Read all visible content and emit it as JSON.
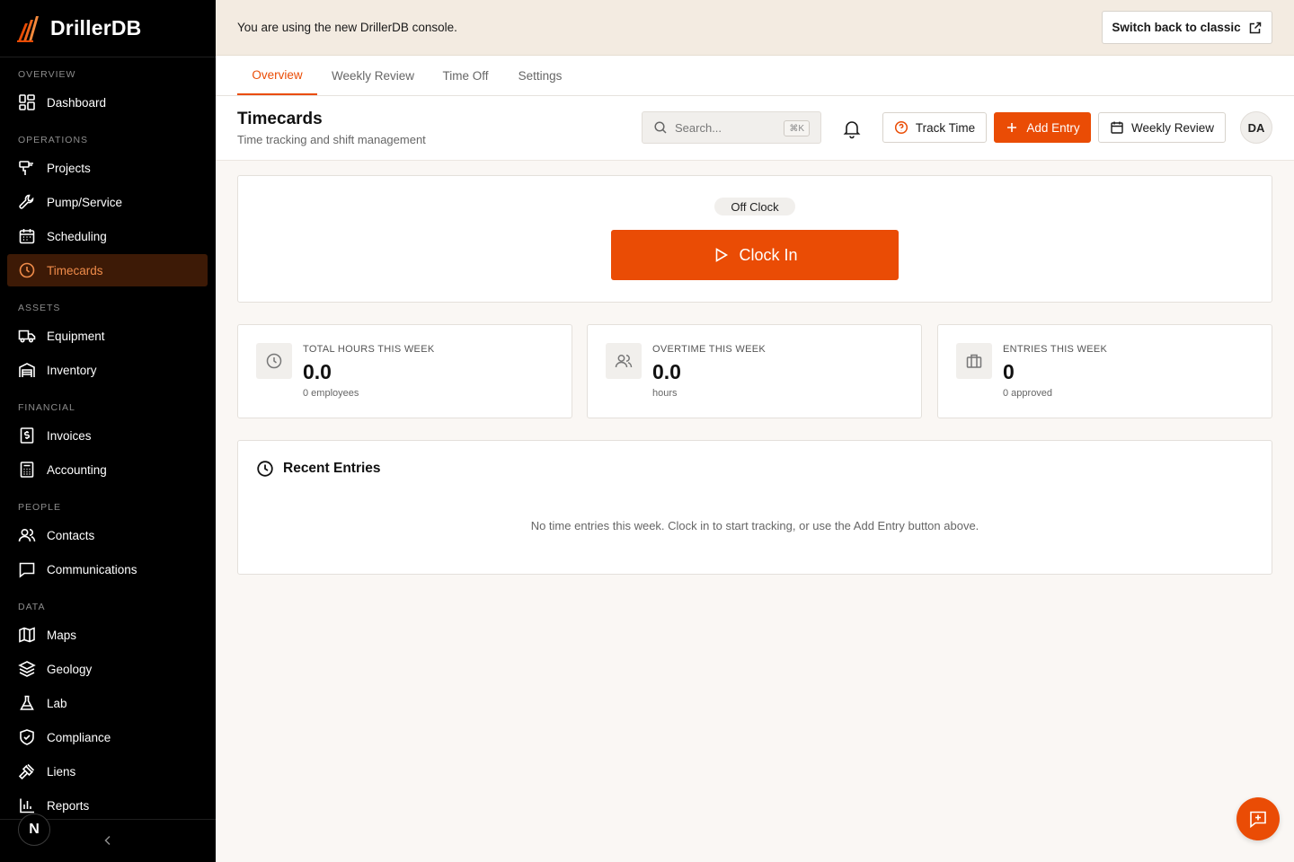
{
  "app": {
    "name": "DrillerDB",
    "logo_icon": "drillerdb-logo"
  },
  "banner": {
    "text": "You are using the new DrillerDB console.",
    "classic_label": "Switch back to classic"
  },
  "sidebar": {
    "sections": [
      "Overview",
      "Operations",
      "Assets",
      "Financial",
      "People",
      "Data"
    ],
    "items": [
      {
        "label": "Dashboard",
        "icon": "dashboard-icon"
      },
      {
        "label": "Projects",
        "icon": "drill-icon"
      },
      {
        "label": "Pump/Service",
        "icon": "wrench-icon"
      },
      {
        "label": "Scheduling",
        "icon": "calendar-icon"
      },
      {
        "label": "Timecards",
        "icon": "clock-icon",
        "active": true
      },
      {
        "label": "Equipment",
        "icon": "truck-icon"
      },
      {
        "label": "Inventory",
        "icon": "warehouse-icon"
      },
      {
        "label": "Invoices",
        "icon": "invoice-icon"
      },
      {
        "label": "Accounting",
        "icon": "calculator-icon"
      },
      {
        "label": "Contacts",
        "icon": "users-icon"
      },
      {
        "label": "Communications",
        "icon": "message-icon"
      },
      {
        "label": "Maps",
        "icon": "map-icon"
      },
      {
        "label": "Geology",
        "icon": "layers-icon"
      },
      {
        "label": "Lab",
        "icon": "flask-icon"
      },
      {
        "label": "Compliance",
        "icon": "shield-icon"
      },
      {
        "label": "Liens",
        "icon": "gavel-icon"
      },
      {
        "label": "Reports",
        "icon": "bar-chart-icon"
      }
    ],
    "footer_badge": "N"
  },
  "tabs": [
    {
      "label": "Overview",
      "active": true
    },
    {
      "label": "Weekly Review"
    },
    {
      "label": "Time Off"
    },
    {
      "label": "Settings"
    }
  ],
  "header": {
    "title": "Timecards",
    "subtitle": "Time tracking and shift management",
    "search_placeholder": "Search...",
    "search_shortcut": "⌘K",
    "track_time_label": "Track Time",
    "add_entry_label": "Add Entry",
    "weekly_review_label": "Weekly Review",
    "avatar_initials": "DA"
  },
  "clock": {
    "status": "Off Clock",
    "button_label": "Clock In"
  },
  "stats": [
    {
      "label": "Total hours this week",
      "value": "0.0",
      "sub": "0 employees",
      "icon": "clock-icon"
    },
    {
      "label": "Overtime this week",
      "value": "0.0",
      "sub": "hours",
      "icon": "users-icon"
    },
    {
      "label": "Entries this week",
      "value": "0",
      "sub": "0 approved",
      "icon": "briefcase-icon"
    }
  ],
  "recent": {
    "title": "Recent Entries",
    "empty_text": "No time entries this week. Clock in to start tracking, or use the Add Entry button above."
  },
  "colors": {
    "accent": "#ea4c05",
    "sidebar_bg": "#000000",
    "active_bg": "#3d1a06",
    "banner_bg": "#f3ebe1"
  }
}
